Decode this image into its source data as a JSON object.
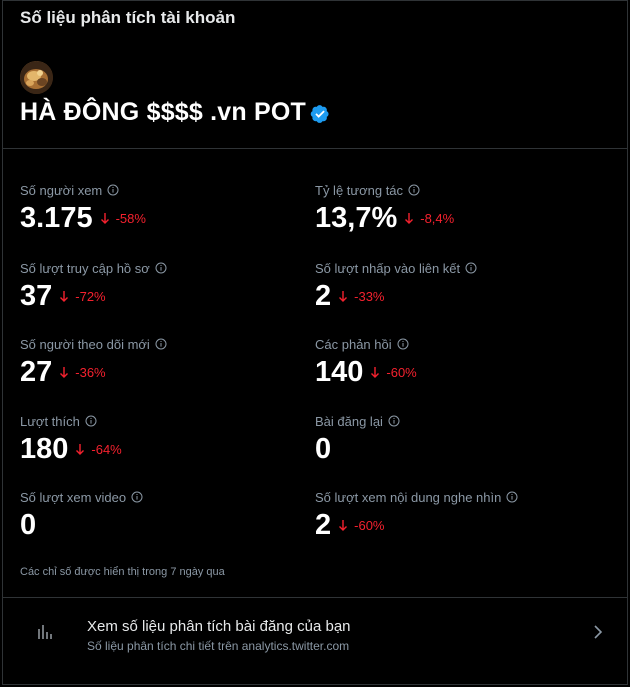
{
  "header": {
    "title": "Số liệu phân tích tài khoản"
  },
  "account": {
    "name": "HÀ ĐÔNG $$$$ .vn POT",
    "verified": true,
    "verified_color": "#1d9bf0"
  },
  "metrics": [
    {
      "label": "Số người xem",
      "value": "3.175",
      "change": "-58%"
    },
    {
      "label": "Tỷ lệ tương tác",
      "value": "13,7%",
      "change": "-8,4%"
    },
    {
      "label": "Số lượt truy cập hồ sơ",
      "value": "37",
      "change": "-72%"
    },
    {
      "label": "Số lượt nhấp vào liên kết",
      "value": "2",
      "change": "-33%"
    },
    {
      "label": "Số người theo dõi mới",
      "value": "27",
      "change": "-36%"
    },
    {
      "label": "Các phản hồi",
      "value": "140",
      "change": "-60%"
    },
    {
      "label": "Lượt thích",
      "value": "180",
      "change": "-64%"
    },
    {
      "label": "Bài đăng lại",
      "value": "0",
      "change": ""
    },
    {
      "label": "Số lượt xem video",
      "value": "0",
      "change": ""
    },
    {
      "label": "Số lượt xem nội dung nghe nhìn",
      "value": "2",
      "change": "-60%"
    }
  ],
  "footnote": "Các chỉ số được hiển thị trong 7 ngày qua",
  "post_analytics_link": {
    "title": "Xem số liệu phân tích bài đăng của bạn",
    "subtitle": "Số liệu phân tích chi tiết trên analytics.twitter.com",
    "icon": "bar-chart-icon"
  },
  "colors": {
    "background": "#000000",
    "negative_change": "#f4212e",
    "secondary_text": "#8b98a5",
    "border": "#2f3336"
  }
}
